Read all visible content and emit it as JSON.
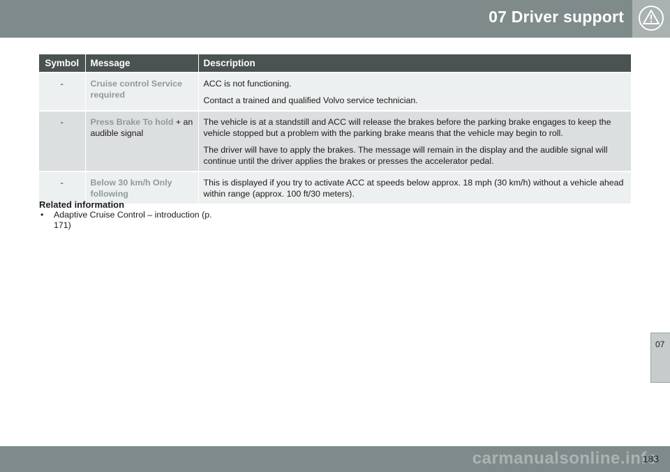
{
  "header": {
    "title": "07 Driver support",
    "icon": "warning-triangle-icon"
  },
  "table": {
    "headers": {
      "symbol": "Symbol",
      "message": "Message",
      "description": "Description"
    },
    "rows": [
      {
        "symbol": "-",
        "message_highlight": "Cruise control Service required",
        "message_rest": "",
        "description": [
          "ACC is not functioning.",
          "Contact a trained and qualified Volvo service technician."
        ]
      },
      {
        "symbol": "-",
        "message_highlight": "Press Brake To hold",
        "message_rest": " + an audible signal",
        "description": [
          "The vehicle is at a standstill and ACC will release the brakes before the parking brake engages to keep the vehicle stopped but a problem with the parking brake means that the vehicle may begin to roll.",
          "The driver will have to apply the brakes. The message will remain in the display and the audible signal will continue until the driver applies the brakes or presses the accelerator pedal."
        ]
      },
      {
        "symbol": "-",
        "message_highlight": "Below 30 km/h Only following",
        "message_rest": "",
        "description": [
          "This is displayed if you try to activate ACC at speeds below approx. 18 mph (30 km/h) without a vehicle ahead within range (approx. 100 ft/30 meters)."
        ]
      }
    ]
  },
  "related": {
    "title": "Related information",
    "bullet": "•",
    "items": [
      {
        "text": "Adaptive Cruise Control – introduction (p. 171)"
      }
    ]
  },
  "side_tab": {
    "label": "07"
  },
  "footer": {
    "page_number": "183",
    "watermark": "carmanualsonline.info"
  }
}
